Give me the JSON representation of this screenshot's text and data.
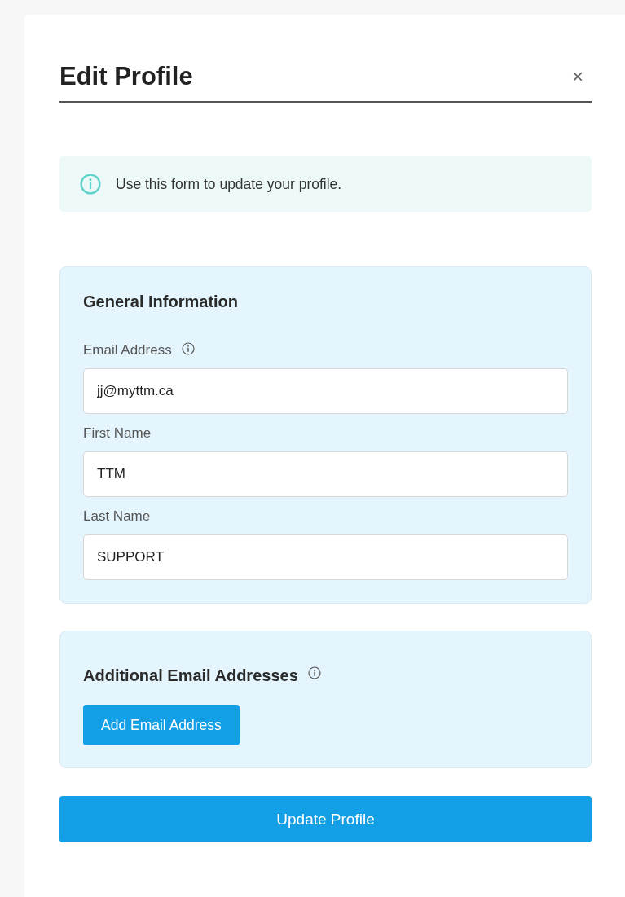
{
  "dialog": {
    "title": "Edit Profile",
    "close": "×"
  },
  "notice": {
    "text": "Use this form to update your profile."
  },
  "general": {
    "title": "General Information",
    "fields": [
      {
        "label": "Email Address",
        "value": "jj@myttm.ca",
        "info": true
      },
      {
        "label": "First Name",
        "value": "TTM",
        "info": false
      },
      {
        "label": "Last Name",
        "value": "SUPPORT",
        "info": false
      }
    ]
  },
  "additional": {
    "title": "Additional Email Addresses",
    "info": true,
    "button": "Add Email Address"
  },
  "submit": "Update Profile"
}
